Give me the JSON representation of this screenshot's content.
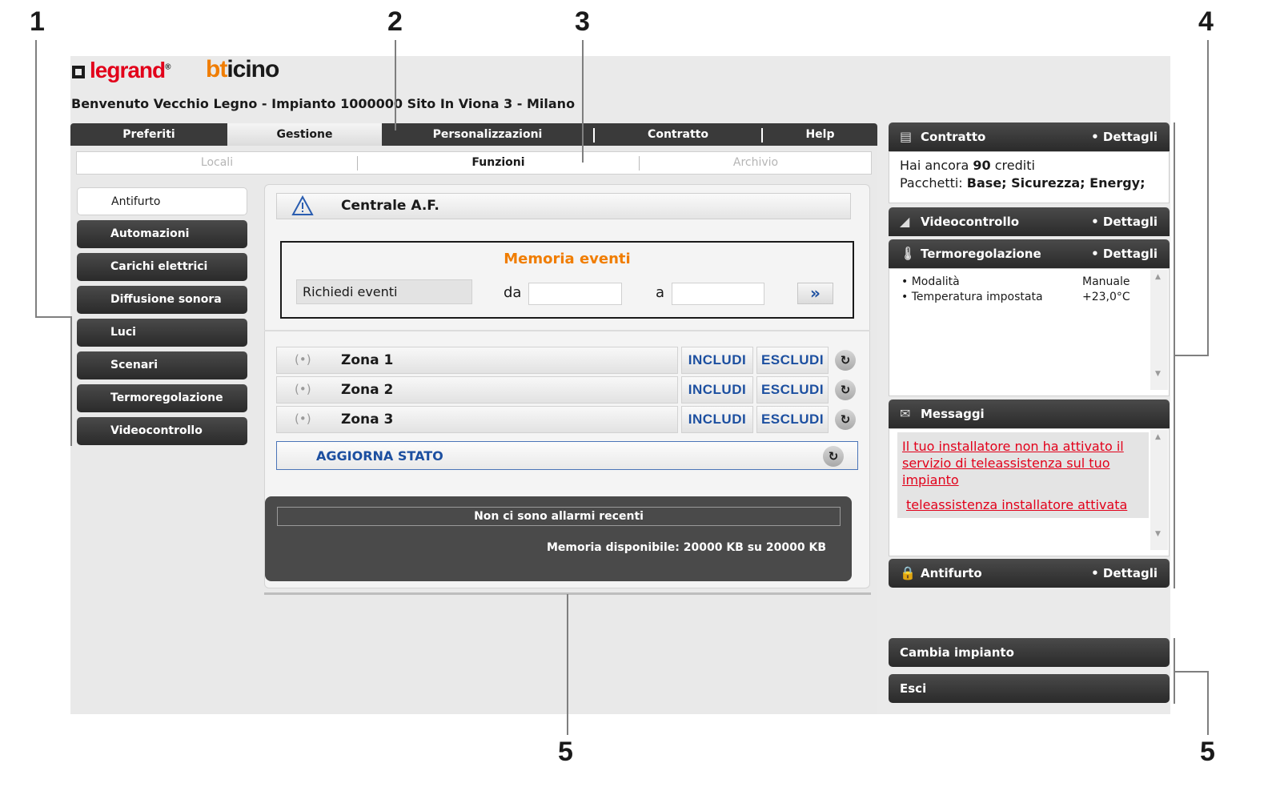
{
  "callouts": [
    "1",
    "2",
    "3",
    "4",
    "5",
    "5"
  ],
  "brand": {
    "legrand": "legrand",
    "registered": "®",
    "bticino_b": "bt",
    "bticino_rest": "icino"
  },
  "welcome": "Benvenuto Vecchio Legno - Impianto 1000000 Sito In Viona 3 - Milano",
  "main_tabs": [
    {
      "label": "Preferiti"
    },
    {
      "label": "Gestione",
      "active": true
    },
    {
      "label": "Personalizzazioni"
    },
    {
      "label": "Contratto"
    },
    {
      "label": "Help"
    }
  ],
  "sub_tabs": [
    {
      "label": "Locali",
      "enabled": false
    },
    {
      "label": "Funzioni",
      "enabled": true
    },
    {
      "label": "Archivio",
      "enabled": false
    }
  ],
  "sidebar": {
    "items": [
      {
        "label": "Antifurto",
        "active": true
      },
      {
        "label": "Automazioni"
      },
      {
        "label": "Carichi elettrici"
      },
      {
        "label": "Diffusione sonora"
      },
      {
        "label": "Luci"
      },
      {
        "label": "Scenari"
      },
      {
        "label": "Termoregolazione"
      },
      {
        "label": "Videocontrollo"
      }
    ]
  },
  "centrale": {
    "label": "Centrale A.F.",
    "icon": "warning-icon"
  },
  "memoria": {
    "title": "Memoria eventi",
    "request_label": "Richiedi eventi",
    "from_label": "da",
    "from_value": "",
    "to_label": "a",
    "to_value": "",
    "go_label": "»"
  },
  "zones": [
    {
      "label": "Zona 1",
      "include": "INCLUDI",
      "exclude": "ESCLUDI"
    },
    {
      "label": "Zona 2",
      "include": "INCLUDI",
      "exclude": "ESCLUDI"
    },
    {
      "label": "Zona 3",
      "include": "INCLUDI",
      "exclude": "ESCLUDI"
    }
  ],
  "zone_icon": "(•)",
  "refresh_glyph": "↻",
  "aggiorna": {
    "label": "AGGIORNA STATO"
  },
  "alarms": {
    "status": "Non ci sono allarmi recenti",
    "memory": "Memoria disponibile: 20000 KB su 20000 KB"
  },
  "right_panel": {
    "contratto": {
      "title": "Contratto",
      "details": "• Dettagli",
      "credits_prefix": "Hai ancora",
      "credits_value": "90",
      "credits_suffix": "crediti",
      "packages_label": "Pacchetti:",
      "packages_value": "Base; Sicurezza; Energy;"
    },
    "videocontrollo": {
      "title": "Videocontrollo",
      "details": "• Dettagli"
    },
    "termoregolazione": {
      "title": "Termoregolazione",
      "details": "• Dettagli",
      "rows": [
        {
          "label": "• Modalità",
          "value": "Manuale"
        },
        {
          "label": "• Temperatura impostata",
          "value": "+23,0°C"
        }
      ]
    },
    "messaggi": {
      "title": "Messaggi",
      "messages": [
        "Il tuo installatore non ha attivato il servizio di teleassistenza sul tuo impianto",
        "teleassistenza installatore attivata"
      ]
    },
    "antifurto": {
      "title": "Antifurto",
      "details": "• Dettagli"
    },
    "buttons": {
      "change_plant": "Cambia impianto",
      "exit": "Esci"
    }
  },
  "colors": {
    "accent_orange": "#f07d00",
    "link_blue": "#1c4fa0",
    "alert_red": "#e2001a",
    "dark_bar": "#3a3a3a"
  }
}
